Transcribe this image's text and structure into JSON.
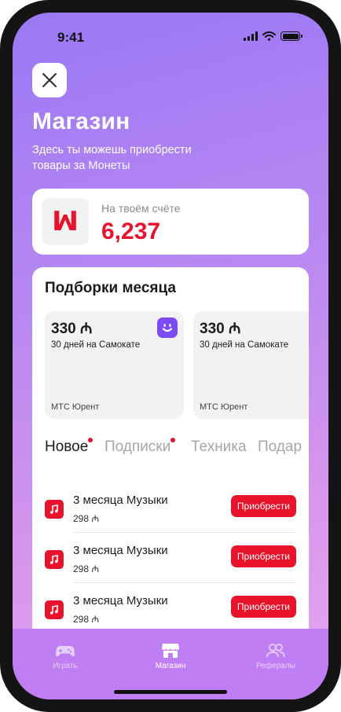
{
  "status_bar": {
    "time": "9:41"
  },
  "header": {
    "title": "Магазин",
    "subtitle": "Здесь ты можешь приобрести товары за Монеты"
  },
  "balance": {
    "label": "На твоём счёте",
    "value": "6,237",
    "coin_icon": "coin-m-icon",
    "coin_glyph": "ꟽ"
  },
  "picks": {
    "title": "Подборки месяца",
    "items": [
      {
        "price": "330 ₼",
        "description": "30 дней на Самокате",
        "partner": "МТС Юрент",
        "icon": "samokat-logo-icon"
      },
      {
        "price": "330 ₼",
        "description": "30 дней на Самокате",
        "partner": "МТС Юрент",
        "icon": "samokat-logo-icon"
      }
    ]
  },
  "categories": {
    "tabs": [
      {
        "label": "Новое",
        "active": true,
        "dot": true
      },
      {
        "label": "Подписки",
        "active": false,
        "dot": true
      },
      {
        "label": "Техника",
        "active": false,
        "dot": false
      },
      {
        "label": "Подар",
        "active": false,
        "dot": false
      }
    ]
  },
  "products": [
    {
      "name": "3 месяца Музыки",
      "price": "298 ₼",
      "button": "Приобрести",
      "icon": "music-note-icon"
    },
    {
      "name": "3 месяца Музыки",
      "price": "298 ₼",
      "button": "Приобрести",
      "icon": "music-note-icon"
    },
    {
      "name": "3 месяца Музыки",
      "price": "298 ₼",
      "button": "Приобрести",
      "icon": "music-note-icon"
    }
  ],
  "tabbar": {
    "items": [
      {
        "label": "Играть",
        "icon": "gamepad-icon",
        "active": false
      },
      {
        "label": "Магазин",
        "icon": "store-icon",
        "active": true
      },
      {
        "label": "Рефералы",
        "icon": "people-icon",
        "active": false
      }
    ]
  },
  "colors": {
    "accent": "#e8122d",
    "brand_purple": "#7b4bf5",
    "tabbar": "#c07ef4"
  }
}
